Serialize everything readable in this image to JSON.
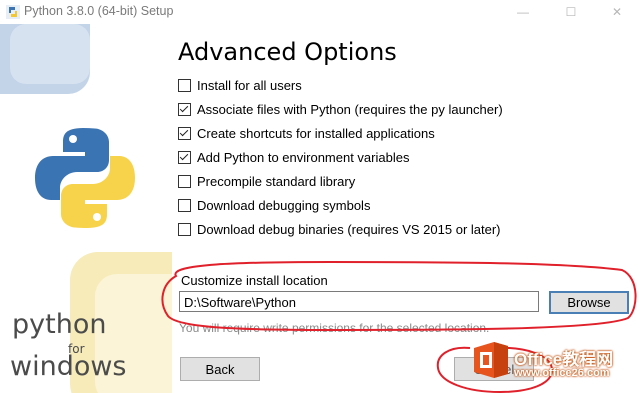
{
  "window": {
    "title": "Python 3.8.0 (64-bit) Setup",
    "minimize_glyph": "—",
    "maximize_glyph": "☐",
    "close_glyph": "✕"
  },
  "branding": {
    "line1": "python",
    "line2": "for",
    "line3": "windows"
  },
  "page": {
    "heading": "Advanced Options"
  },
  "options": [
    {
      "label": "Install for all users",
      "checked": false
    },
    {
      "label": "Associate files with Python (requires the py launcher)",
      "checked": true
    },
    {
      "label": "Create shortcuts for installed applications",
      "checked": true
    },
    {
      "label": "Add Python to environment variables",
      "checked": true
    },
    {
      "label": "Precompile standard library",
      "checked": false
    },
    {
      "label": "Download debugging symbols",
      "checked": false
    },
    {
      "label": "Download debug binaries (requires VS 2015 or later)",
      "checked": false
    }
  ],
  "location": {
    "label": "Customize install location",
    "value": "D:\\Software\\Python",
    "browse_label": "Browse",
    "note": "You will require write permissions for the selected location."
  },
  "buttons": {
    "back": "Back",
    "cancel": "Cancel"
  },
  "watermark": {
    "title": "Office教程网",
    "url": "www.office26.com"
  },
  "colors": {
    "annotation": "#e0202a",
    "python_blue": "#3b74b3",
    "python_yellow": "#f6d34a",
    "button_focus": "#4a7fb5"
  }
}
